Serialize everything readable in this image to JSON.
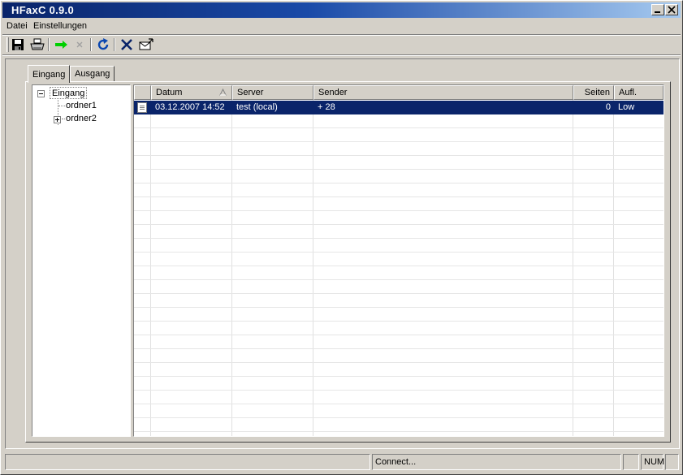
{
  "window": {
    "title": "HFaxC 0.9.0"
  },
  "menu": {
    "items": [
      "Datei",
      "Einstellungen"
    ]
  },
  "toolbar": {
    "buttons": [
      "save-icon",
      "print-icon",
      "forward-arrow-icon",
      "disabled-x-icon",
      "refresh-icon",
      "delete-icon",
      "send-fax-icon"
    ]
  },
  "tabs": [
    {
      "label": "Eingang",
      "active": true
    },
    {
      "label": "Ausgang",
      "active": false
    }
  ],
  "tree": {
    "root": "Eingang",
    "children": [
      "ordner1",
      "ordner2"
    ]
  },
  "list": {
    "columns": [
      "",
      "Datum",
      "Server",
      "Sender",
      "Seiten",
      "Aufl."
    ],
    "sort_column": "Datum",
    "rows": [
      {
        "datum": "03.12.2007 14:52",
        "server": "test (local)",
        "sender": "+  28",
        "seiten": "0",
        "aufl": "Low",
        "selected": true
      }
    ]
  },
  "status": {
    "text": "Connect...",
    "num": "NUM"
  },
  "colors": {
    "title_start": "#0a246a",
    "title_end": "#a6caf0",
    "selection": "#0a246a",
    "face": "#d4d0c8"
  }
}
